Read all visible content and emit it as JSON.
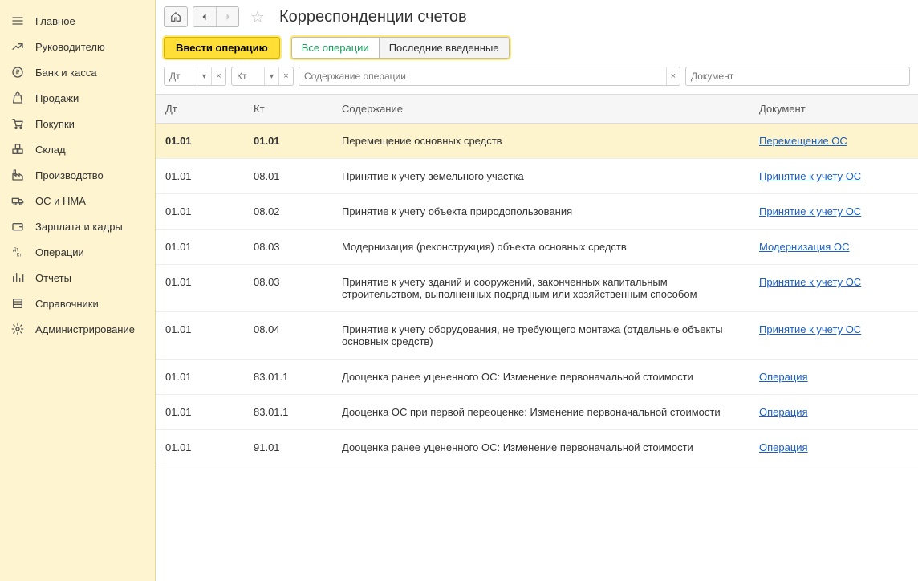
{
  "sidebar": {
    "items": [
      {
        "label": "Главное",
        "icon": "menu"
      },
      {
        "label": "Руководителю",
        "icon": "chart"
      },
      {
        "label": "Банк и касса",
        "icon": "ruble"
      },
      {
        "label": "Продажи",
        "icon": "bag"
      },
      {
        "label": "Покупки",
        "icon": "cart"
      },
      {
        "label": "Склад",
        "icon": "boxes"
      },
      {
        "label": "Производство",
        "icon": "factory"
      },
      {
        "label": "ОС и НМА",
        "icon": "truck"
      },
      {
        "label": "Зарплата и кадры",
        "icon": "wallet"
      },
      {
        "label": "Операции",
        "icon": "dtkt"
      },
      {
        "label": "Отчеты",
        "icon": "report"
      },
      {
        "label": "Справочники",
        "icon": "book"
      },
      {
        "label": "Администрирование",
        "icon": "gear"
      }
    ]
  },
  "header": {
    "title": "Корреспонденции счетов"
  },
  "toolbar": {
    "primary_label": "Ввести операцию",
    "tab_all": "Все операции",
    "tab_recent": "Последние введенные"
  },
  "filters": {
    "dt_placeholder": "Дт",
    "kt_placeholder": "Кт",
    "content_placeholder": "Содержание операции",
    "doc_placeholder": "Документ"
  },
  "table": {
    "headers": {
      "dt": "Дт",
      "kt": "Кт",
      "content": "Содержание",
      "doc": "Документ"
    },
    "rows": [
      {
        "dt": "01.01",
        "kt": "01.01",
        "content": "Перемещение основных средств",
        "doc": "Перемещение ОС",
        "selected": true
      },
      {
        "dt": "01.01",
        "kt": "08.01",
        "content": "Принятие к учету земельного участка",
        "doc": "Принятие к учету ОС"
      },
      {
        "dt": "01.01",
        "kt": "08.02",
        "content": "Принятие к учету объекта природопользования",
        "doc": "Принятие к учету ОС"
      },
      {
        "dt": "01.01",
        "kt": "08.03",
        "content": "Модернизация (реконструкция) объекта основных средств",
        "doc": "Модернизация ОС"
      },
      {
        "dt": "01.01",
        "kt": "08.03",
        "content": "Принятие к учету зданий и сооружений, законченных капитальным строительством, выполненных подрядным или хозяйственным способом",
        "doc": "Принятие к учету ОС"
      },
      {
        "dt": "01.01",
        "kt": "08.04",
        "content": "Принятие к учету оборудования, не требующего монтажа (отдельные объекты основных средств)",
        "doc": "Принятие к учету ОС"
      },
      {
        "dt": "01.01",
        "kt": "83.01.1",
        "content": "Дооценка ранее уцененного ОС: Изменение первоначальной стоимости",
        "doc": "Операция"
      },
      {
        "dt": "01.01",
        "kt": "83.01.1",
        "content": "Дооценка ОС при первой переоценке: Изменение первоначальной стоимости",
        "doc": "Операция"
      },
      {
        "dt": "01.01",
        "kt": "91.01",
        "content": "Дооценка ранее уцененного ОС: Изменение первоначальной стоимости",
        "doc": "Операция"
      }
    ]
  }
}
